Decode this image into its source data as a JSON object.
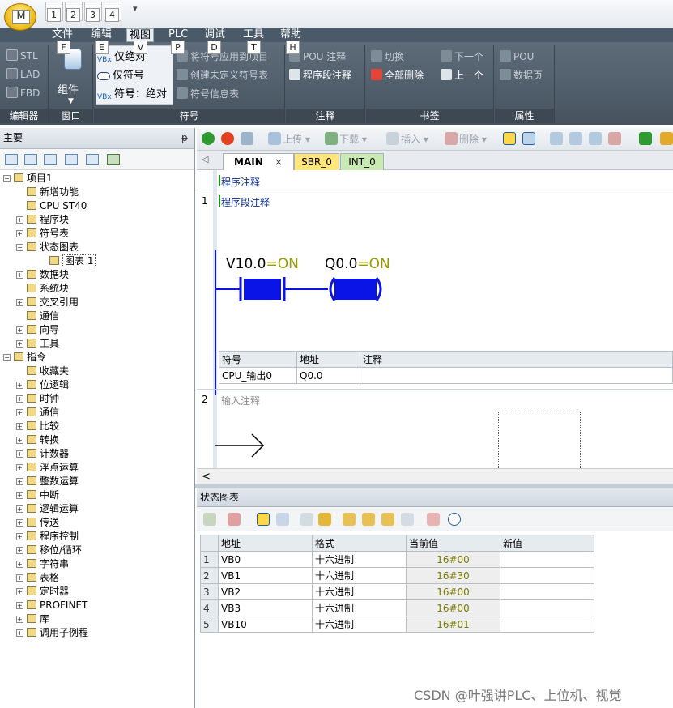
{
  "app": {
    "button_label": "M"
  },
  "quick_access": {
    "items": [
      "1",
      "2",
      "3",
      "4"
    ],
    "more": "▾"
  },
  "ribbon": {
    "tabs": [
      {
        "label": "文件",
        "keytip": "F"
      },
      {
        "label": "编辑",
        "keytip": "E"
      },
      {
        "label": "视图",
        "keytip": "V",
        "active": true
      },
      {
        "label": "PLC",
        "keytip": "P"
      },
      {
        "label": "调试",
        "keytip": "D"
      },
      {
        "label": "工具",
        "keytip": "T"
      },
      {
        "label": "帮助",
        "keytip": "H"
      }
    ],
    "groups": {
      "editor": {
        "label": "编辑器",
        "items": [
          "STL",
          "LAD",
          "FBD"
        ]
      },
      "window": {
        "label": "窗口",
        "button": "组件"
      },
      "symbol": {
        "label": "符号",
        "items": [
          "仅绝对",
          "仅符号",
          "符号：绝对",
          "将符号应用到项目",
          "创建未定义符号表",
          "符号信息表"
        ]
      },
      "comment": {
        "label": "注释",
        "items": [
          "POU 注释",
          "程序段注释"
        ]
      },
      "bookmark": {
        "label": "书签",
        "items": [
          "切换",
          "下一个",
          "全部删除",
          "上一个"
        ]
      },
      "property": {
        "label": "属性",
        "items": [
          "POU",
          "数据页"
        ]
      }
    }
  },
  "nav": {
    "title": "主要",
    "pin": "ᵽ",
    "tree": [
      {
        "label": "项目1",
        "level": 0,
        "expander": "-"
      },
      {
        "label": "新增功能",
        "level": 1,
        "expander": ""
      },
      {
        "label": "CPU ST40",
        "level": 1,
        "expander": ""
      },
      {
        "label": "程序块",
        "level": 1,
        "expander": "+"
      },
      {
        "label": "符号表",
        "level": 1,
        "expander": "+"
      },
      {
        "label": "状态图表",
        "level": 1,
        "expander": "-"
      },
      {
        "label": "图表 1",
        "level": 2,
        "expander": "",
        "selected": true
      },
      {
        "label": "数据块",
        "level": 1,
        "expander": "+"
      },
      {
        "label": "系统块",
        "level": 1,
        "expander": ""
      },
      {
        "label": "交叉引用",
        "level": 1,
        "expander": "+"
      },
      {
        "label": "通信",
        "level": 1,
        "expander": ""
      },
      {
        "label": "向导",
        "level": 1,
        "expander": "+"
      },
      {
        "label": "工具",
        "level": 1,
        "expander": "+"
      },
      {
        "label": "指令",
        "level": 0,
        "expander": "-"
      },
      {
        "label": "收藏夹",
        "level": 1,
        "expander": ""
      },
      {
        "label": "位逻辑",
        "level": 1,
        "expander": "+"
      },
      {
        "label": "时钟",
        "level": 1,
        "expander": "+"
      },
      {
        "label": "通信",
        "level": 1,
        "expander": "+"
      },
      {
        "label": "比较",
        "level": 1,
        "expander": "+"
      },
      {
        "label": "转换",
        "level": 1,
        "expander": "+"
      },
      {
        "label": "计数器",
        "level": 1,
        "expander": "+"
      },
      {
        "label": "浮点运算",
        "level": 1,
        "expander": "+"
      },
      {
        "label": "整数运算",
        "level": 1,
        "expander": "+"
      },
      {
        "label": "中断",
        "level": 1,
        "expander": "+"
      },
      {
        "label": "逻辑运算",
        "level": 1,
        "expander": "+"
      },
      {
        "label": "传送",
        "level": 1,
        "expander": "+"
      },
      {
        "label": "程序控制",
        "level": 1,
        "expander": "+"
      },
      {
        "label": "移位/循环",
        "level": 1,
        "expander": "+"
      },
      {
        "label": "字符串",
        "level": 1,
        "expander": "+"
      },
      {
        "label": "表格",
        "level": 1,
        "expander": "+"
      },
      {
        "label": "定时器",
        "level": 1,
        "expander": "+"
      },
      {
        "label": "PROFINET",
        "level": 1,
        "expander": "+"
      },
      {
        "label": "库",
        "level": 1,
        "expander": "+"
      },
      {
        "label": "调用子例程",
        "level": 1,
        "expander": "+"
      }
    ]
  },
  "editor": {
    "toolbar": {
      "upload": "上传",
      "download": "下载",
      "insert": "插入",
      "delete": "删除"
    },
    "tabs": [
      {
        "label": "MAIN",
        "close": "×",
        "active": true
      },
      {
        "label": "SBR_0"
      },
      {
        "label": "INT_0"
      }
    ],
    "program_comment": "程序注释",
    "networks": [
      {
        "number": "1",
        "comment": "程序段注释",
        "contact": {
          "address": "V10.0",
          "state": "=ON"
        },
        "coil": {
          "address": "Q0.0",
          "state": "=ON"
        },
        "symbol_table": {
          "headers": [
            "符号",
            "地址",
            "注释"
          ],
          "rows": [
            [
              "CPU_输出0",
              "Q0.0",
              ""
            ]
          ]
        }
      },
      {
        "number": "2",
        "comment": "输入注释"
      }
    ],
    "scroll_left": "<"
  },
  "status_chart": {
    "title": "状态图表",
    "headers": [
      "",
      "地址",
      "格式",
      "当前值",
      "新值"
    ],
    "rows": [
      {
        "n": "1",
        "address": "VB0",
        "format": "十六进制",
        "current": "16#00",
        "new": ""
      },
      {
        "n": "2",
        "address": "VB1",
        "format": "十六进制",
        "current": "16#30",
        "new": ""
      },
      {
        "n": "3",
        "address": "VB2",
        "format": "十六进制",
        "current": "16#00",
        "new": ""
      },
      {
        "n": "4",
        "address": "VB3",
        "format": "十六进制",
        "current": "16#00",
        "new": ""
      },
      {
        "n": "5",
        "address": "VB10",
        "format": "十六进制",
        "current": "16#01",
        "new": ""
      }
    ]
  },
  "watermark": "CSDN @叶强讲PLC、上位机、视觉",
  "colors": {
    "accent_blue": "#0a14e6",
    "on_green": "#9a9a00",
    "ribbon_bg": "#4b5a68",
    "status_value": "#7a7a00"
  }
}
